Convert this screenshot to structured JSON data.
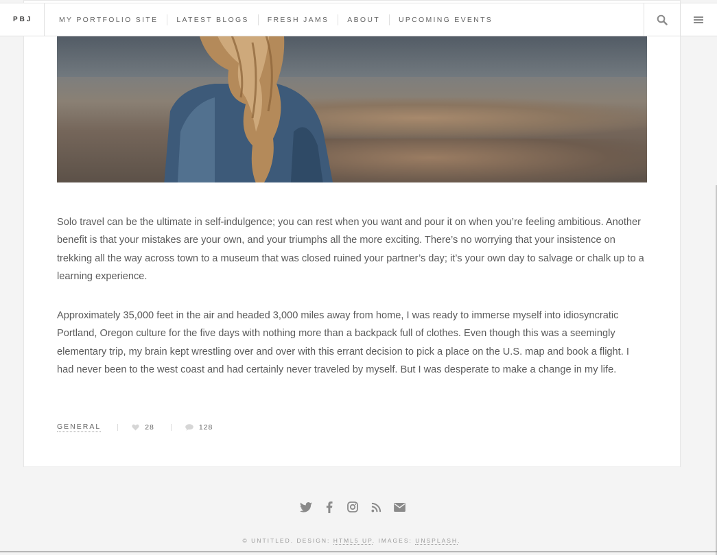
{
  "header": {
    "brand": "PBJ",
    "nav": [
      {
        "label": "MY PORTFOLIO SITE"
      },
      {
        "label": "LATEST BLOGS"
      },
      {
        "label": "FRESH JAMS"
      },
      {
        "label": "ABOUT"
      },
      {
        "label": "UPCOMING EVENTS"
      }
    ],
    "search_icon": "search-icon",
    "menu_icon": "hamburger-menu-icon"
  },
  "post": {
    "image": "hero-photo-woman-overlooking-valley",
    "paragraphs": [
      "Solo travel can be the ultimate in self-indulgence; you can rest when you want and pour it on when you’re feeling ambitious. Another benefit is that your mistakes are your own, and your triumphs all the more exciting. There’s no worrying that your insistence on trekking all the way across town to a museum that was closed ruined your partner’s day; it’s your own day to salvage or chalk up to a learning experience.",
      "Approximately 35,000 feet in the air and headed 3,000 miles away from home, I was ready to immerse myself into idiosyncratic Portland, Oregon culture for the five days with nothing more than a backpack full of clothes. Even though this was a seemingly elementary trip, my brain kept wrestling over and over with this errant decision to pick a place on the U.S. map and book a flight. I had never been to the west coast and had certainly never traveled by myself. But I was desperate to make a change in my life."
    ],
    "meta": {
      "category": "GENERAL",
      "likes": "28",
      "comments": "128"
    }
  },
  "footer": {
    "social_icons": [
      "twitter-icon",
      "facebook-icon",
      "instagram-icon",
      "rss-icon",
      "email-icon"
    ],
    "copyright": "© UNTITLED. DESIGN: ",
    "design_link": "HTML5 UP",
    "images_label": ". IMAGES: ",
    "images_link": "UNSPLASH",
    "end": "."
  },
  "colors": {
    "background": "#f4f4f4",
    "panel": "#ffffff",
    "text": "#5a5a5a",
    "border": "#e0e0e0"
  }
}
